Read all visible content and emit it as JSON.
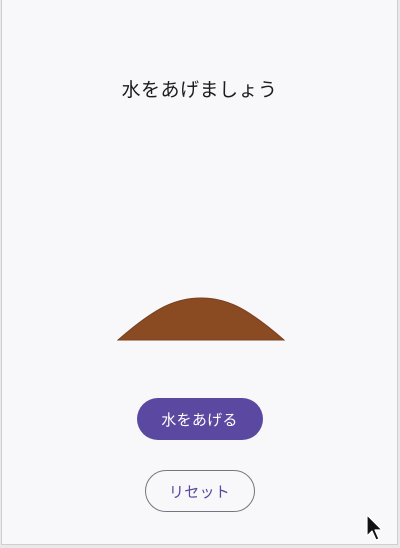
{
  "screen": {
    "title": "水をあげましょう"
  },
  "soil": {
    "color": "#8a4a22",
    "edge_color": "#7a4220"
  },
  "buttons": {
    "water_label": "水をあげる",
    "reset_label": "リセット"
  },
  "colors": {
    "primary": "#5b48a0",
    "background": "#f8f7f9",
    "outline": "#78757f"
  }
}
